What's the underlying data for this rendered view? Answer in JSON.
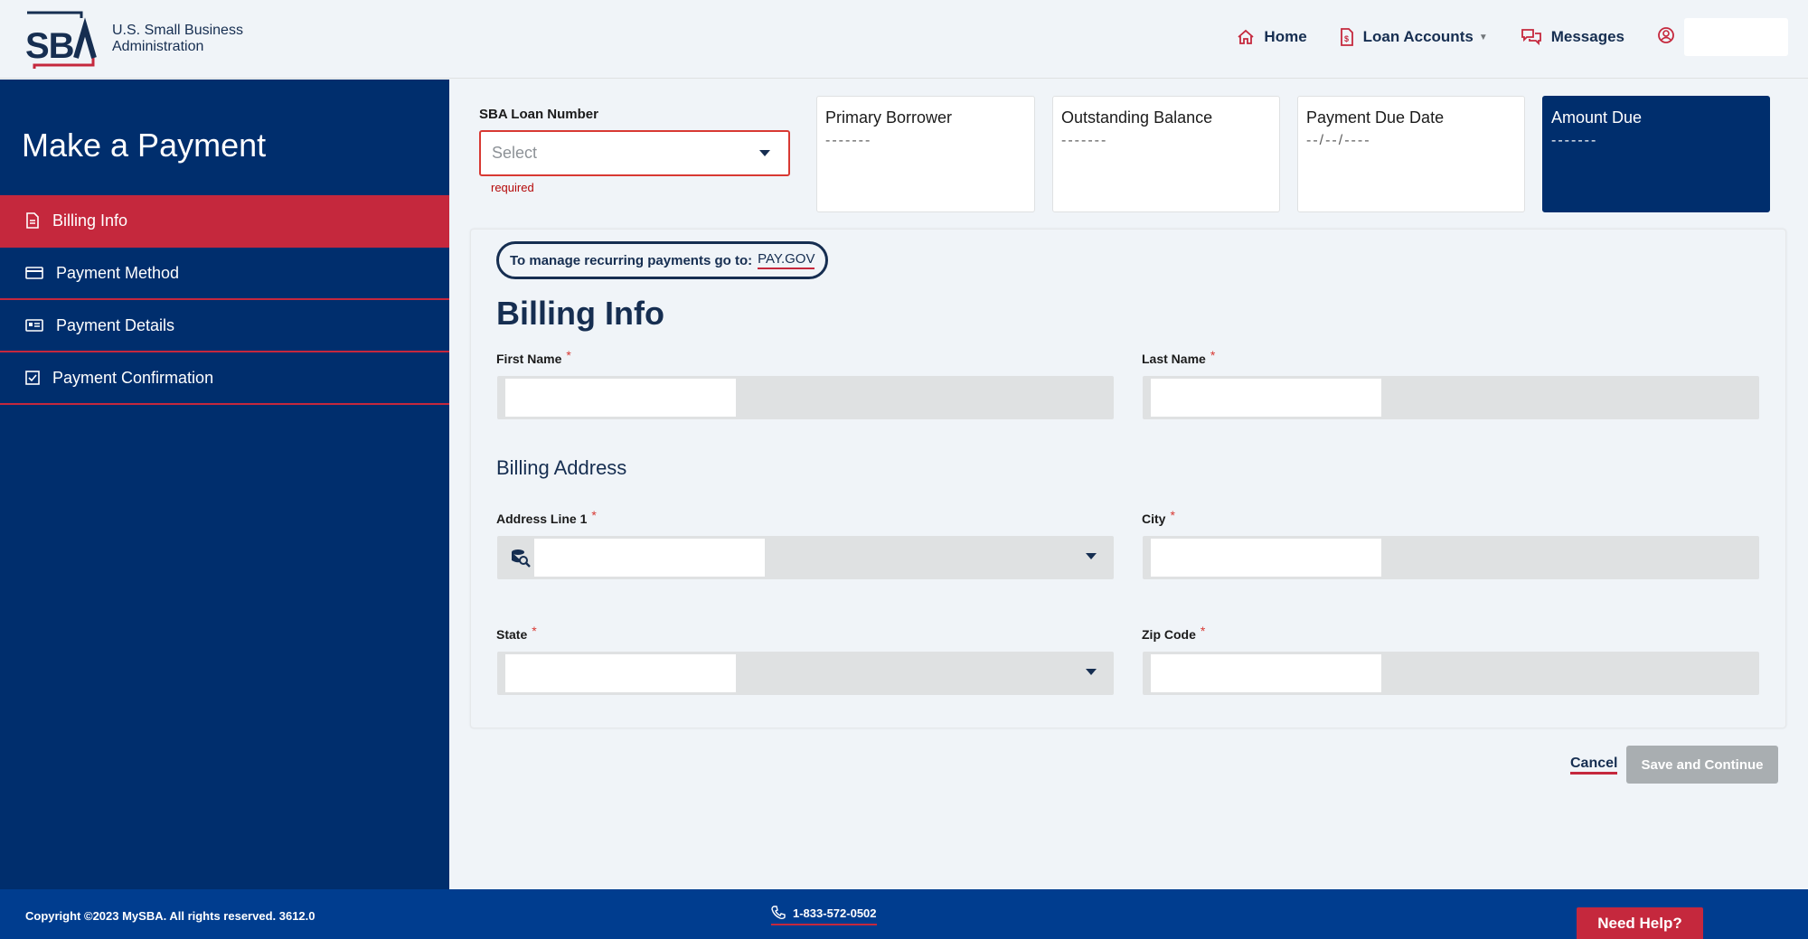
{
  "header": {
    "logo_line1": "U.S. Small Business",
    "logo_line2": "Administration",
    "logo_mark": "SBA",
    "nav": {
      "home": "Home",
      "loan_accounts": "Loan Accounts",
      "messages": "Messages"
    }
  },
  "sidebar": {
    "title": "Make a Payment",
    "items": [
      {
        "label": "Billing Info",
        "icon": "document-icon",
        "active": true
      },
      {
        "label": "Payment Method",
        "icon": "credit-card-icon"
      },
      {
        "label": "Payment Details",
        "icon": "id-card-icon"
      },
      {
        "label": "Payment Confirmation",
        "icon": "check-box-icon"
      }
    ]
  },
  "summary": {
    "loan_label": "SBA Loan Number",
    "loan_placeholder": "Select",
    "loan_required": "required",
    "primary_borrower": {
      "title": "Primary Borrower",
      "value": "-------"
    },
    "outstanding_balance": {
      "title": "Outstanding Balance",
      "value": "-------"
    },
    "payment_due_date": {
      "title": "Payment Due Date",
      "value": "--/--/----"
    },
    "amount_due": {
      "title": "Amount Due",
      "value": "-------"
    }
  },
  "panel": {
    "recurring_text": "To manage recurring payments go to:",
    "recurring_link": "PAY.GOV",
    "title": "Billing Info",
    "first_name_label": "First Name",
    "last_name_label": "Last Name",
    "billing_address_label": "Billing Address",
    "address_line1_label": "Address Line 1",
    "city_label": "City",
    "state_label": "State",
    "zip_label": "Zip Code",
    "required_mark": "*"
  },
  "actions": {
    "cancel": "Cancel",
    "save": "Save and Continue"
  },
  "footer": {
    "copyright": "Copyright ©2023 MySBA. All rights reserved. 3612.0",
    "phone": "1-833-572-0502",
    "help": "Need Help?"
  },
  "colors": {
    "navy": "#002e6d",
    "red": "#c5283d",
    "footer_blue": "#003d8f",
    "disabled": "#a9aeb1"
  }
}
